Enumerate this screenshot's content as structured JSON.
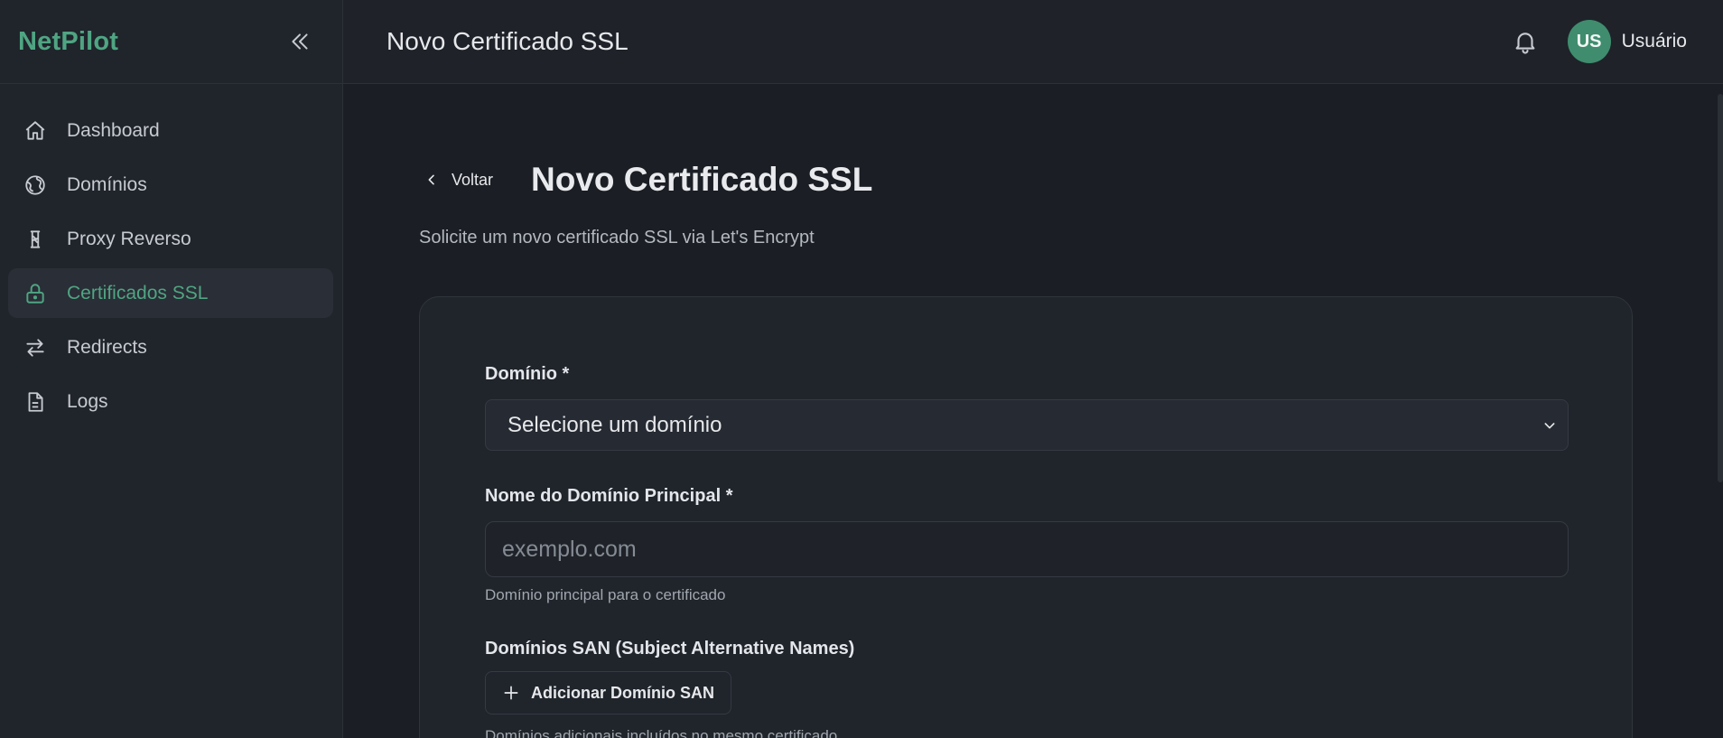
{
  "app": {
    "name": "NetPilot"
  },
  "sidebar": {
    "items": [
      {
        "label": "Dashboard",
        "icon": "home-icon",
        "active": false
      },
      {
        "label": "Domínios",
        "icon": "globe-icon",
        "active": false
      },
      {
        "label": "Proxy Reverso",
        "icon": "proxy-icon",
        "active": false
      },
      {
        "label": "Certificados SSL",
        "icon": "lock-icon",
        "active": true
      },
      {
        "label": "Redirects",
        "icon": "arrows-swap-icon",
        "active": false
      },
      {
        "label": "Logs",
        "icon": "file-text-icon",
        "active": false
      }
    ]
  },
  "header": {
    "title": "Novo Certificado SSL"
  },
  "user": {
    "initials": "US",
    "name": "Usuário"
  },
  "page": {
    "back_label": "Voltar",
    "title": "Novo Certificado SSL",
    "subtitle": "Solicite um novo certificado SSL via Let's Encrypt"
  },
  "form": {
    "domain_label": "Domínio *",
    "domain_selected": "Selecione um domínio",
    "main_domain_label": "Nome do Domínio Principal *",
    "main_domain_value": "",
    "main_domain_placeholder": "exemplo.com",
    "main_domain_help": "Domínio principal para o certificado",
    "san_label": "Domínios SAN (Subject Alternative Names)",
    "add_san_label": "Adicionar Domínio SAN",
    "san_help": "Domínios adicionais incluídos no mesmo certificado"
  },
  "colors": {
    "accent": "#4fa583",
    "background": "#1b1e24",
    "sidebar": "#20242b",
    "avatar": "#3f8d6e"
  }
}
